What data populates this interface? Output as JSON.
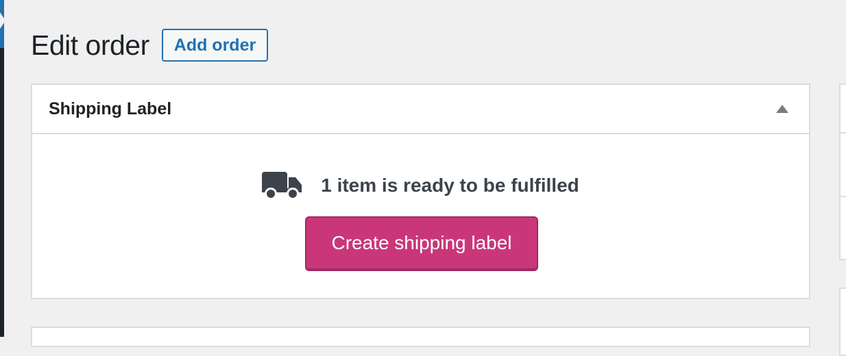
{
  "header": {
    "title": "Edit order",
    "add_button_label": "Add order"
  },
  "shipping_box": {
    "title": "Shipping Label",
    "toggle_icon": "triangle-up-icon",
    "status_icon": "truck-icon",
    "status_text": "1 item is ready to be fulfilled",
    "create_button_label": "Create shipping label"
  },
  "colors": {
    "background": "#f0f0f1",
    "accent_blue": "#2271b1",
    "primary_button": "#c9377a",
    "text_dark": "#1d2327"
  }
}
